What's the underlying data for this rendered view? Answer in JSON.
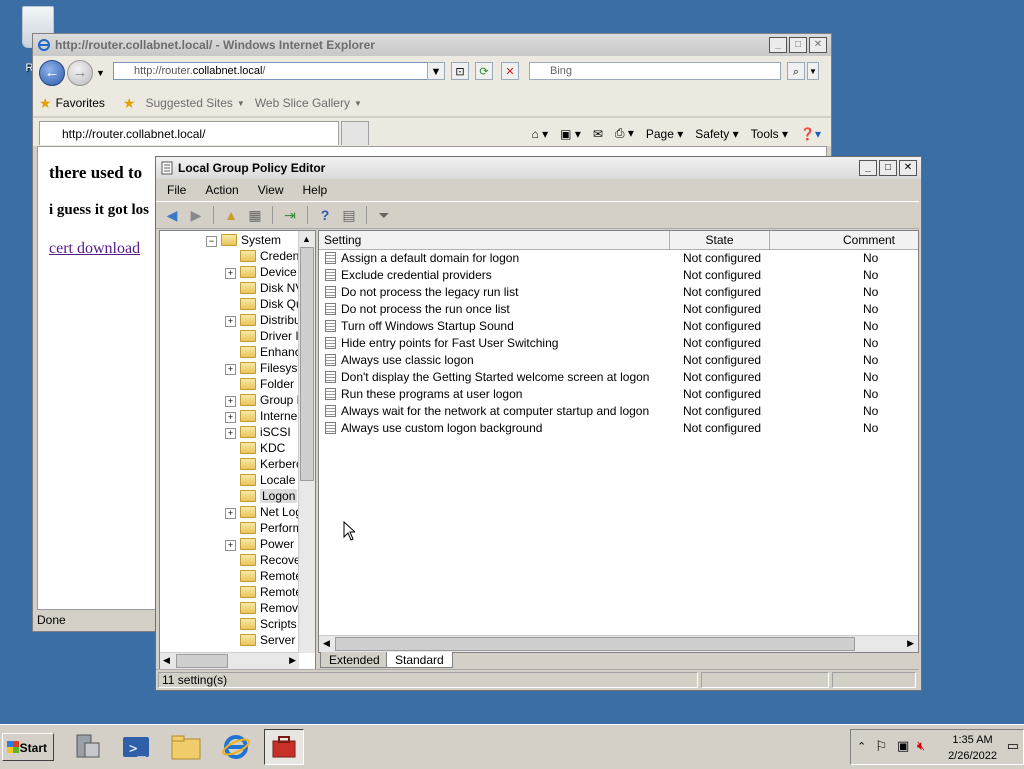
{
  "desktop": {
    "recycle_bin_label": "Recy"
  },
  "ie": {
    "title": "http://router.collabnet.local/ - Windows Internet Explorer",
    "address_prefix": "http://router.",
    "address_domain": "collabnet.local",
    "address_suffix": "/",
    "search_placeholder": "Bing",
    "favorites": "Favorites",
    "suggested_sites": "Suggested Sites",
    "web_slice_gallery": "Web Slice Gallery",
    "tab_title": "http://router.collabnet.local/",
    "cmd_page": "Page",
    "cmd_safety": "Safety",
    "cmd_tools": "Tools",
    "content_line1": "there used to",
    "content_line2": "i guess it got los",
    "content_link": "cert download",
    "status": "Done"
  },
  "gpo": {
    "title": "Local Group Policy Editor",
    "menu": [
      "File",
      "Action",
      "View",
      "Help"
    ],
    "tree_root": "System",
    "tree_items": [
      {
        "label": "Creden",
        "expandable": false
      },
      {
        "label": "Device I",
        "expandable": true
      },
      {
        "label": "Disk NV",
        "expandable": false
      },
      {
        "label": "Disk Qu",
        "expandable": false
      },
      {
        "label": "Distribu",
        "expandable": true
      },
      {
        "label": "Driver I",
        "expandable": false
      },
      {
        "label": "Enhanc",
        "expandable": false
      },
      {
        "label": "Filesyst",
        "expandable": true
      },
      {
        "label": "Folder R",
        "expandable": false
      },
      {
        "label": "Group P",
        "expandable": true
      },
      {
        "label": "Interne",
        "expandable": true
      },
      {
        "label": "iSCSI",
        "expandable": true
      },
      {
        "label": "KDC",
        "expandable": false
      },
      {
        "label": "Kerberc",
        "expandable": false
      },
      {
        "label": "Locale S",
        "expandable": false
      },
      {
        "label": "Logon",
        "expandable": false,
        "selected": true
      },
      {
        "label": "Net Log",
        "expandable": true
      },
      {
        "label": "Perform",
        "expandable": false
      },
      {
        "label": "Power N",
        "expandable": true
      },
      {
        "label": "Recove",
        "expandable": false
      },
      {
        "label": "Remote",
        "expandable": false
      },
      {
        "label": "Remote",
        "expandable": false
      },
      {
        "label": "Remova",
        "expandable": false
      },
      {
        "label": "Scripts",
        "expandable": false
      },
      {
        "label": "Server I",
        "expandable": false
      }
    ],
    "columns": [
      "Setting",
      "State",
      "Comment"
    ],
    "rows": [
      {
        "setting": "Assign a default domain for logon",
        "state": "Not configured",
        "comment": "No"
      },
      {
        "setting": "Exclude credential providers",
        "state": "Not configured",
        "comment": "No"
      },
      {
        "setting": "Do not process the legacy run list",
        "state": "Not configured",
        "comment": "No"
      },
      {
        "setting": "Do not process the run once list",
        "state": "Not configured",
        "comment": "No"
      },
      {
        "setting": "Turn off Windows Startup Sound",
        "state": "Not configured",
        "comment": "No"
      },
      {
        "setting": "Hide entry points for Fast User Switching",
        "state": "Not configured",
        "comment": "No"
      },
      {
        "setting": "Always use classic logon",
        "state": "Not configured",
        "comment": "No"
      },
      {
        "setting": "Don't display the Getting Started welcome screen at logon",
        "state": "Not configured",
        "comment": "No"
      },
      {
        "setting": "Run these programs at user logon",
        "state": "Not configured",
        "comment": "No"
      },
      {
        "setting": "Always wait for the network at computer startup and logon",
        "state": "Not configured",
        "comment": "No"
      },
      {
        "setting": "Always use custom logon background",
        "state": "Not configured",
        "comment": "No"
      }
    ],
    "view_tabs": [
      "Extended",
      "Standard"
    ],
    "status": "11 setting(s)"
  },
  "taskbar": {
    "start": "Start",
    "time": "1:35 AM",
    "date": "2/26/2022"
  }
}
